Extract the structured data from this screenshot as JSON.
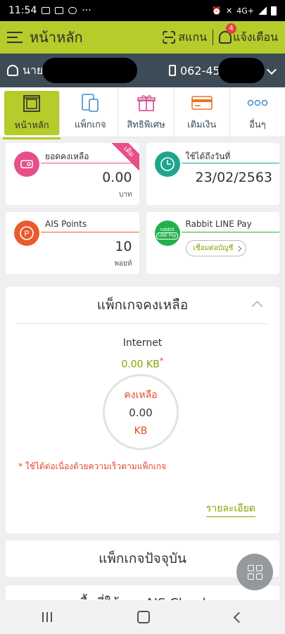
{
  "status_bar": {
    "time": "11:54",
    "dots": "···",
    "net": "4G+"
  },
  "app_bar": {
    "title": "หน้าหลัก",
    "scan_label": "สแกน",
    "notif_label": "แจ้งเตือน",
    "notif_count": "4"
  },
  "user": {
    "name_prefix": "นาย ฐ",
    "phone_prefix": "062-459-2"
  },
  "tabs": [
    {
      "label": "หน้าหลัก",
      "icon": "home-icon"
    },
    {
      "label": "แพ็กเกจ",
      "icon": "devices-icon"
    },
    {
      "label": "สิทธิพิเศษ",
      "icon": "gift-icon"
    },
    {
      "label": "เติมเงิน",
      "icon": "card-icon"
    },
    {
      "label": "อื่นๆ",
      "icon": "more-icon"
    }
  ],
  "cards": {
    "balance": {
      "title": "ยอดคงเหลือ",
      "value": "0.00",
      "unit": "บาท",
      "ribbon": "เติม",
      "color": "#e84e89"
    },
    "valid": {
      "title": "ใช้ได้ถึงวันที่",
      "value": "23/02/2563",
      "color": "#1fa58c"
    },
    "points": {
      "title": "AIS Points",
      "value": "10",
      "unit": "พอยท์",
      "color": "#ea5a2d"
    },
    "rabbit": {
      "title": "Rabbit LINE Pay",
      "button": "เชื่อมต่อบัญชี",
      "logo_top": "rabbit",
      "logo_bottom": "LINE Pay",
      "color": "#22b14c"
    }
  },
  "package": {
    "heading": "แพ็กเกจคงเหลือ",
    "label": "Internet",
    "amount": "0.00 KB",
    "asterisk": "*",
    "circle_title": "คงเหลือ",
    "circle_value": "0.00",
    "circle_unit": "KB",
    "note": "* ใช้ได้ต่อเนื่องด้วยความเร็วตามแพ็กเกจ",
    "detail_link": "รายละเอียด"
  },
  "current_package": {
    "heading": "แพ็กเกจปัจจุบัน"
  },
  "cloud": {
    "heading": "พื้นที่ใช้งาน AIS Cloud"
  },
  "colors": {
    "accent": "#b5cc2a",
    "dark": "#3c4b56",
    "orange": "#e34b2e",
    "green_text": "#8aa100"
  }
}
